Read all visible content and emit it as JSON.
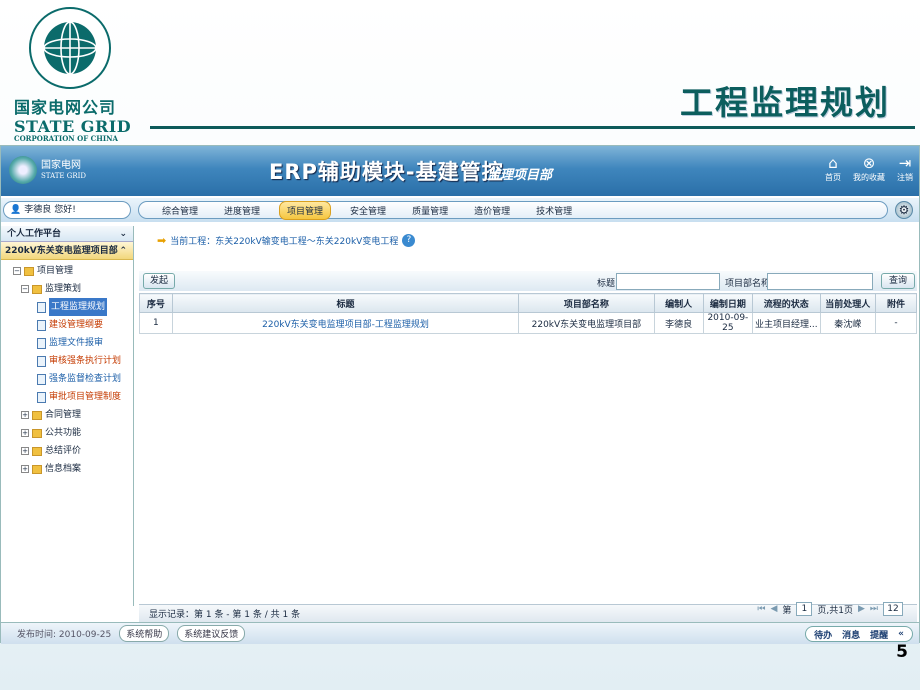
{
  "slide": {
    "title": "工程监理规划",
    "brand_cn": "国家电网公司",
    "brand_en": "STATE GRID",
    "brand_sub": "CORPORATION OF CHINA",
    "page_number": "5"
  },
  "topbar": {
    "brand_cn": "国家电网",
    "brand_en": "STATE GRID",
    "title": "ERP辅助模块-基建管控",
    "subtitle": "监理项目部",
    "icons": [
      {
        "icon": "home-icon",
        "label": "首页"
      },
      {
        "icon": "favorites-icon",
        "label": "我的收藏"
      },
      {
        "icon": "logout-icon",
        "label": "注销"
      }
    ]
  },
  "user": {
    "name": "李德良",
    "greeting": "您好!"
  },
  "menu": {
    "items": [
      "综合管理",
      "进度管理",
      "项目管理",
      "安全管理",
      "质量管理",
      "造价管理",
      "技术管理"
    ],
    "active": "项目管理"
  },
  "sidebar": {
    "header": "个人工作平台",
    "project": "220kV东关变电监理项目部",
    "tree": [
      {
        "label": "项目管理",
        "level": 1,
        "toggle": "⊟"
      },
      {
        "label": "监理策划",
        "level": 2,
        "toggle": "⊟"
      },
      {
        "label": "工程监理规划",
        "level": 3,
        "state": "selected"
      },
      {
        "label": "建设管理纲要",
        "level": 3,
        "state": "orange"
      },
      {
        "label": "监理文件报审",
        "level": 3,
        "state": "normal"
      },
      {
        "label": "审核强条执行计划",
        "level": 3,
        "state": "orange"
      },
      {
        "label": "强条监督检查计划",
        "level": 3,
        "state": "normal"
      },
      {
        "label": "审批项目管理制度",
        "level": 3,
        "state": "orange"
      },
      {
        "label": "合同管理",
        "level": 2,
        "toggle": "⊞"
      },
      {
        "label": "公共功能",
        "level": 2,
        "toggle": "⊞"
      },
      {
        "label": "总结评价",
        "level": 2,
        "toggle": "⊞"
      },
      {
        "label": "信息档案",
        "level": 2,
        "toggle": "⊞"
      }
    ]
  },
  "main": {
    "crumb": "当前工程：东关220kV输变电工程～东关220kV变电工程",
    "new_button": "发起",
    "search": {
      "title_label": "标题",
      "project_label": "项目部名称",
      "button": "查询"
    },
    "columns": [
      "序号",
      "标题",
      "项目部名称",
      "编制人",
      "编制日期",
      "流程的状态",
      "当前处理人",
      "附件"
    ],
    "rows": [
      [
        "1",
        "220kV东关变电监理项目部-工程监理规划",
        "220kV东关变电监理项目部",
        "李德良",
        "2010-09-25",
        "业主项目经理...",
        "秦沈嵘",
        "-"
      ]
    ],
    "status": "显示记录：第 1 条 - 第 1 条 / 共 1 条",
    "pager": {
      "prefix": "第",
      "page": "1",
      "suffix": "页,共1页",
      "page_size": "12"
    }
  },
  "footer": {
    "date_label": "发布时间: 2010-09-25",
    "buttons": [
      "系统帮助",
      "系统建议反馈"
    ],
    "right": [
      "待办",
      "消息",
      "提醒"
    ]
  }
}
